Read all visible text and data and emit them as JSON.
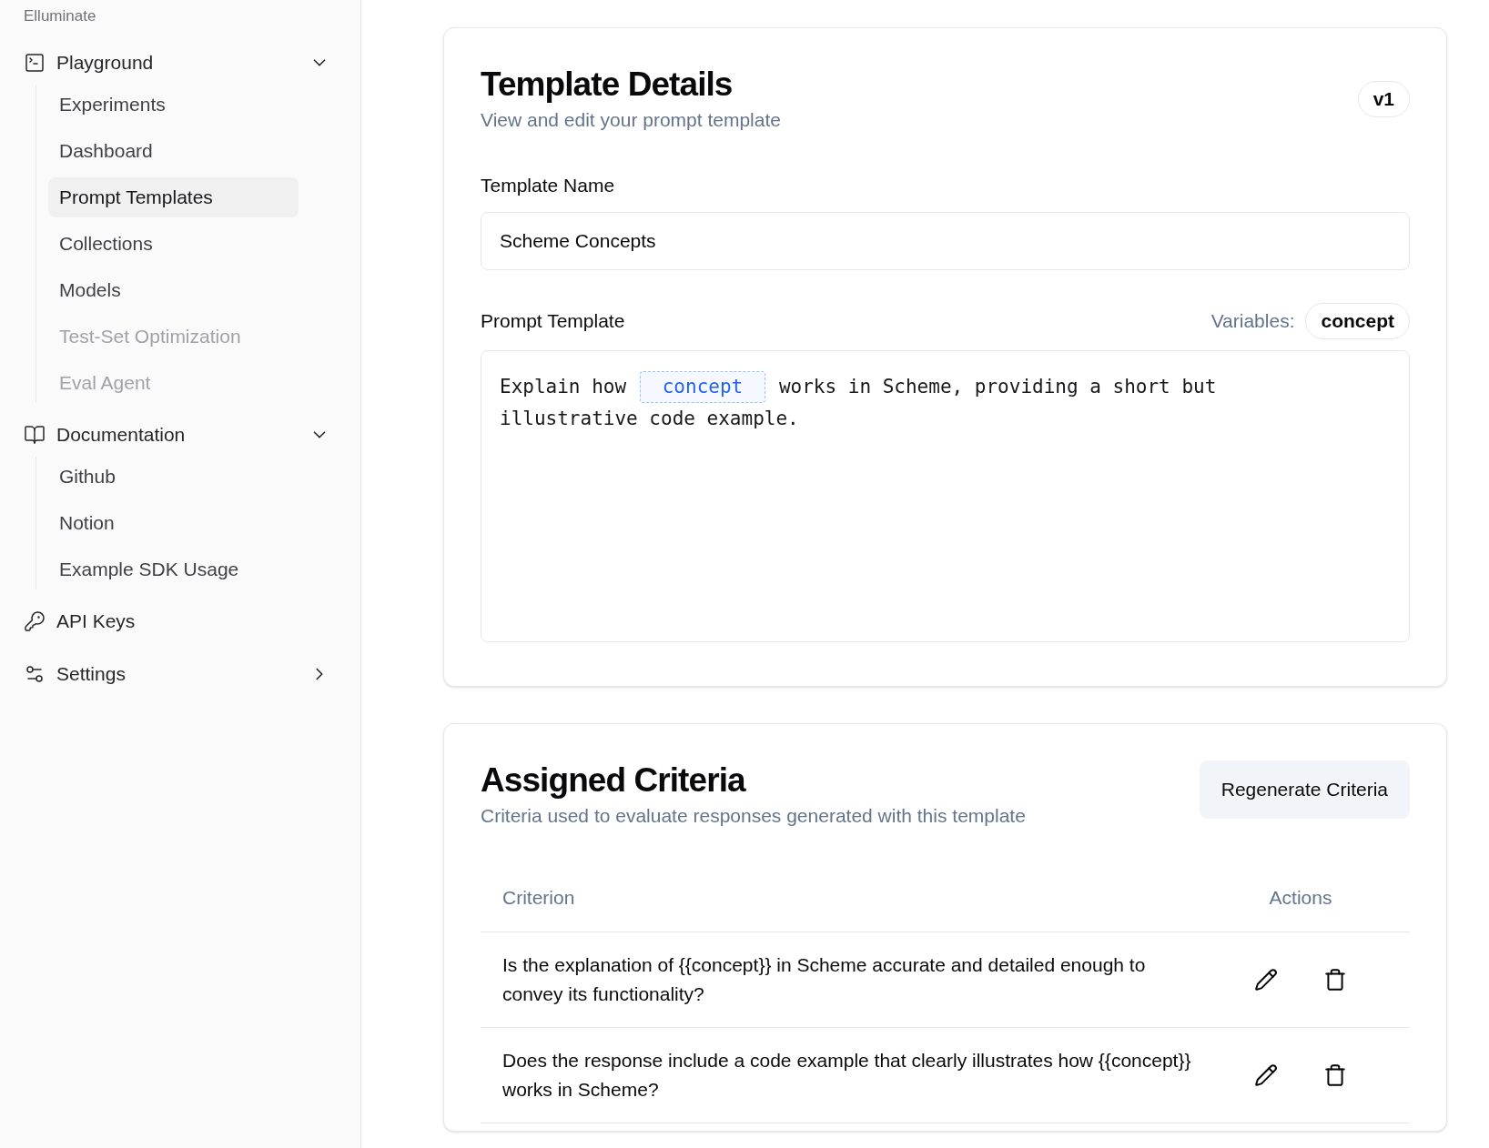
{
  "sidebar": {
    "brand": "Elluminate",
    "items": [
      {
        "kind": "group",
        "label": "Playground",
        "expanded": true,
        "children": [
          {
            "label": "Experiments",
            "selected": false,
            "disabled": false
          },
          {
            "label": "Dashboard",
            "selected": false,
            "disabled": false
          },
          {
            "label": "Prompt Templates",
            "selected": true,
            "disabled": false
          },
          {
            "label": "Collections",
            "selected": false,
            "disabled": false
          },
          {
            "label": "Models",
            "selected": false,
            "disabled": false
          },
          {
            "label": "Test-Set Optimization",
            "selected": false,
            "disabled": true
          },
          {
            "label": "Eval Agent",
            "selected": false,
            "disabled": true
          }
        ]
      },
      {
        "kind": "group",
        "label": "Documentation",
        "expanded": true,
        "children": [
          {
            "label": "Github",
            "selected": false,
            "disabled": false
          },
          {
            "label": "Notion",
            "selected": false,
            "disabled": false
          },
          {
            "label": "Example SDK Usage",
            "selected": false,
            "disabled": false
          }
        ]
      },
      {
        "kind": "link",
        "label": "API Keys"
      },
      {
        "kind": "group",
        "label": "Settings",
        "expanded": false
      }
    ]
  },
  "details": {
    "title": "Template Details",
    "subtitle": "View and edit your prompt template",
    "version": "v1",
    "name_label": "Template Name",
    "name_value": "Scheme Concepts",
    "prompt_label": "Prompt Template",
    "variables_label": "Variables:",
    "variables": [
      "concept"
    ],
    "prompt": [
      {
        "kind": "text",
        "text": "Explain how "
      },
      {
        "kind": "variable",
        "text": "concept"
      },
      {
        "kind": "text",
        "text": " works in Scheme, providing a short but illustrative code example."
      }
    ]
  },
  "criteria": {
    "title": "Assigned Criteria",
    "subtitle": "Criteria used to evaluate responses generated with this template",
    "button": "Regenerate Criteria",
    "columns": [
      "Criterion",
      "Actions"
    ],
    "rows": [
      "Is the explanation of {{concept}} in Scheme accurate and detailed enough to convey its functionality?",
      "Does the response include a code example that clearly illustrates how {{concept}} works in Scheme?"
    ]
  }
}
